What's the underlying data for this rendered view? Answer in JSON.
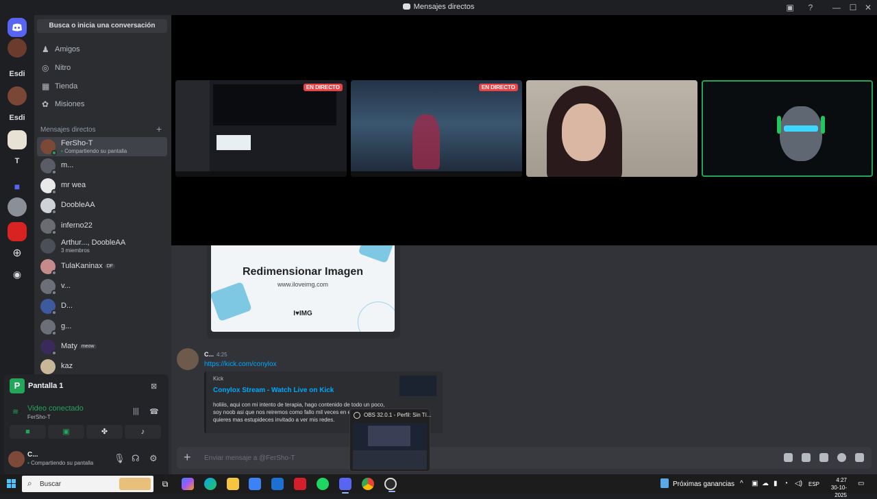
{
  "window": {
    "title": "Mensajes directos"
  },
  "guilds": [
    {
      "abbr": "Esdi"
    },
    {
      "abbr": "Esdi"
    },
    {
      "abbr": "T"
    }
  ],
  "sidebar": {
    "search_label": "Busca o inicia una conversación",
    "nav": [
      {
        "label": "Amigos",
        "icon": "friends-icon"
      },
      {
        "label": "Nitro",
        "icon": "nitro-icon"
      },
      {
        "label": "Tienda",
        "icon": "shop-icon"
      },
      {
        "label": "Misiones",
        "icon": "quests-icon"
      }
    ],
    "dm_header": "Mensajes directos",
    "dms": [
      {
        "name": "FerSho-T",
        "sub": "Compartiendo su pantalla"
      },
      {
        "name": "m..."
      },
      {
        "name": "mr wea"
      },
      {
        "name": "DoobleAA"
      },
      {
        "name": "inferno22"
      },
      {
        "name": "Arthur..., DoobleAA",
        "sub": "3 miembros"
      },
      {
        "name": "TulaKaninax",
        "badge": "DF"
      },
      {
        "name": "v..."
      },
      {
        "name": "D..."
      },
      {
        "name": "g..."
      },
      {
        "name": "Maty",
        "badge": "meow"
      },
      {
        "name": "kaz"
      }
    ]
  },
  "voice": {
    "logo_letter": "P",
    "title": "Pantalla 1",
    "connection": "Video conectado",
    "user": "FerSho-T"
  },
  "user_panel": {
    "name": "C...",
    "status": "Compartiendo su pantalla"
  },
  "stage": {
    "live_label": "EN DIRECTO"
  },
  "chat": {
    "image": {
      "title": "Redimensionar Imagen",
      "url": "www.iloveimg.com",
      "logo": "I♥IMG"
    },
    "message": {
      "author": "C...",
      "time": "4:25",
      "link": "https://kick.com/conylox",
      "embed": {
        "provider": "Kick",
        "title": "Conylox Stream - Watch Live on Kick",
        "description": "holiiis, aqui con mi intento de terapia, hago contenido de todo un poco, soy noob asi que nos reiremos como fallo mil veces en el juego, si quieres mas estupideces invitado a ver mis redes."
      }
    },
    "composer_placeholder": "Enviar mensaje a @FerSho-T"
  },
  "obs_preview": {
    "title": "OBS 32.0.1 - Perfil: Sin Tí..."
  },
  "taskbar": {
    "search": "Buscar",
    "widget": "Próximas ganancias",
    "lang": "ESP",
    "time": "4:27",
    "date": "30-10-2025"
  },
  "colors": {
    "discord_blurple": "#5865f2",
    "online_green": "#23a55a",
    "live_red": "#ed4245",
    "link_blue": "#00a8fc"
  }
}
